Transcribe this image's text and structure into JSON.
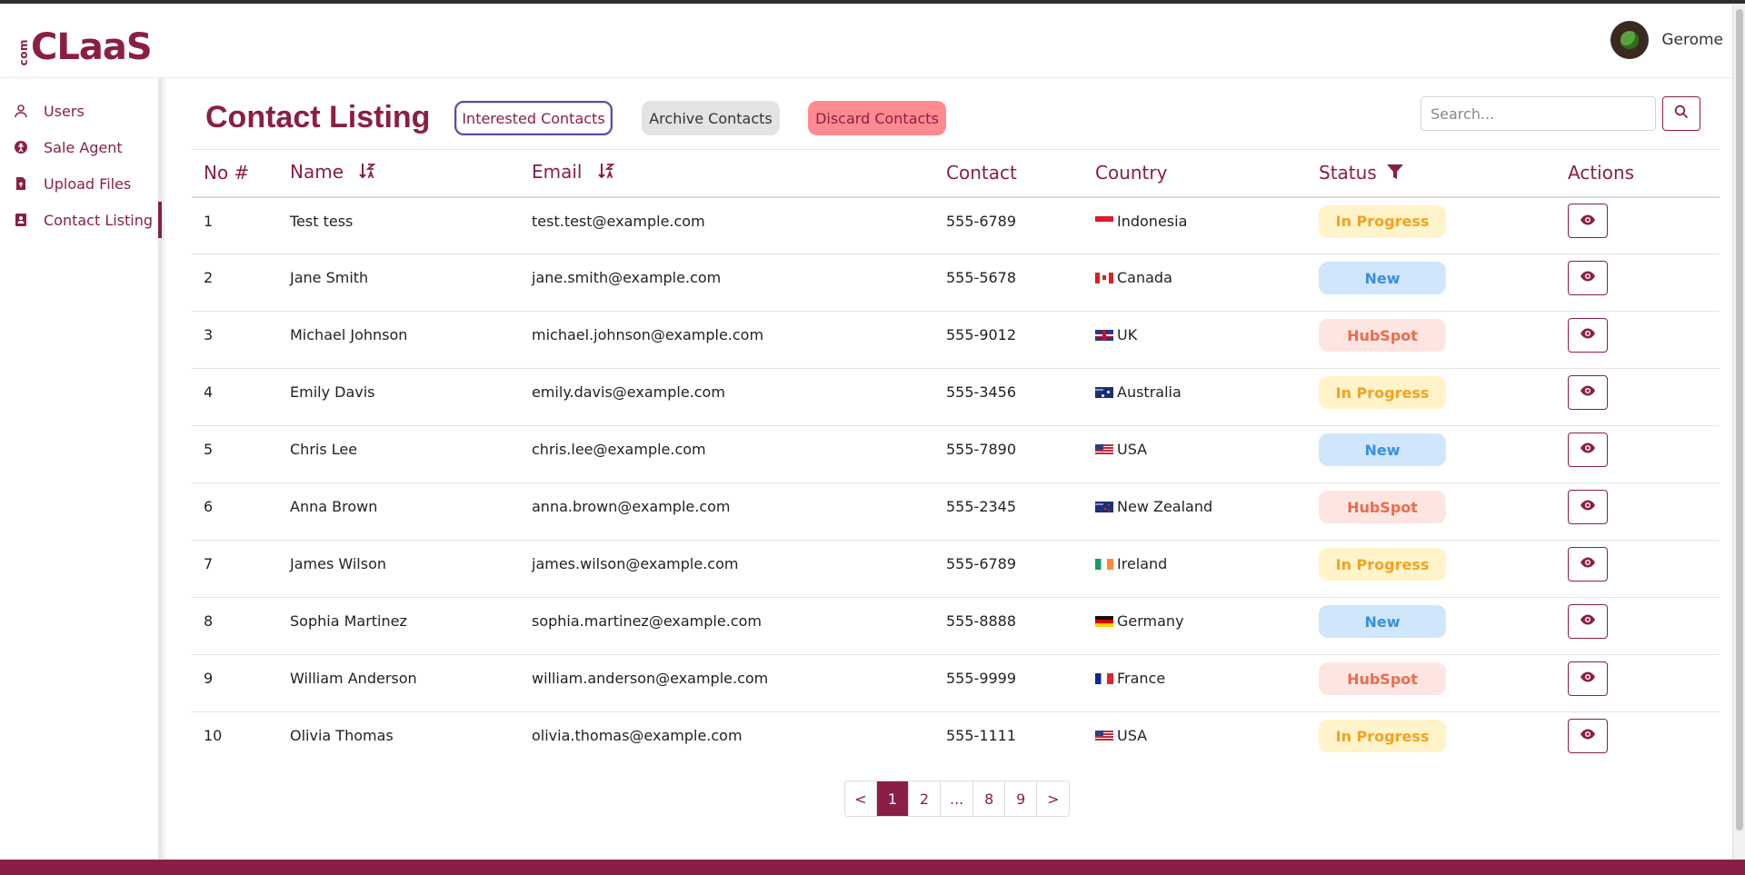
{
  "app": {
    "logo_prefix": "com",
    "logo_text": "CLaaS",
    "user_name": "Gerome"
  },
  "sidebar": {
    "items": [
      {
        "label": "Users",
        "icon": "user-icon"
      },
      {
        "label": "Sale Agent",
        "icon": "agent-icon"
      },
      {
        "label": "Upload Files",
        "icon": "upload-file-icon"
      },
      {
        "label": "Contact Listing",
        "icon": "contact-book-icon",
        "active": true
      }
    ]
  },
  "page": {
    "title": "Contact Listing",
    "tabs": {
      "interested": "Interested Contacts",
      "archive": "Archive Contacts",
      "discard": "Discard Contacts"
    },
    "search_placeholder": "Search..."
  },
  "table": {
    "headers": {
      "no": "No #",
      "name": "Name",
      "email": "Email",
      "contact": "Contact",
      "country": "Country",
      "status": "Status",
      "actions": "Actions"
    },
    "rows": [
      {
        "no": "1",
        "name": "Test tess",
        "email": "test.test@example.com",
        "contact": "555-6789",
        "country": "Indonesia",
        "flag": "indonesia",
        "status": "In Progress",
        "status_type": "progress"
      },
      {
        "no": "2",
        "name": "Jane Smith",
        "email": "jane.smith@example.com",
        "contact": "555-5678",
        "country": "Canada",
        "flag": "canada",
        "status": "New",
        "status_type": "new"
      },
      {
        "no": "3",
        "name": "Michael Johnson",
        "email": "michael.johnson@example.com",
        "contact": "555-9012",
        "country": "UK",
        "flag": "uk",
        "status": "HubSpot",
        "status_type": "hubspot"
      },
      {
        "no": "4",
        "name": "Emily Davis",
        "email": "emily.davis@example.com",
        "contact": "555-3456",
        "country": "Australia",
        "flag": "australia",
        "status": "In Progress",
        "status_type": "progress"
      },
      {
        "no": "5",
        "name": "Chris Lee",
        "email": "chris.lee@example.com",
        "contact": "555-7890",
        "country": "USA",
        "flag": "usa",
        "status": "New",
        "status_type": "new"
      },
      {
        "no": "6",
        "name": "Anna Brown",
        "email": "anna.brown@example.com",
        "contact": "555-2345",
        "country": "New Zealand",
        "flag": "nz",
        "status": "HubSpot",
        "status_type": "hubspot"
      },
      {
        "no": "7",
        "name": "James Wilson",
        "email": "james.wilson@example.com",
        "contact": "555-6789",
        "country": "Ireland",
        "flag": "ireland",
        "status": "In Progress",
        "status_type": "progress"
      },
      {
        "no": "8",
        "name": "Sophia Martinez",
        "email": "sophia.martinez@example.com",
        "contact": "555-8888",
        "country": "Germany",
        "flag": "germany",
        "status": "New",
        "status_type": "new"
      },
      {
        "no": "9",
        "name": "William Anderson",
        "email": "william.anderson@example.com",
        "contact": "555-9999",
        "country": "France",
        "flag": "france",
        "status": "HubSpot",
        "status_type": "hubspot"
      },
      {
        "no": "10",
        "name": "Olivia Thomas",
        "email": "olivia.thomas@example.com",
        "contact": "555-1111",
        "country": "USA",
        "flag": "usa",
        "status": "In Progress",
        "status_type": "progress"
      }
    ]
  },
  "pagination": {
    "prev": "<",
    "pages": [
      "1",
      "2",
      "...",
      "8",
      "9"
    ],
    "current": "1",
    "next": ">"
  },
  "colors": {
    "brand": "#8b1e46",
    "status_progress": "#f2a321",
    "status_new": "#3a90dc",
    "status_hubspot": "#ee6a4d"
  }
}
